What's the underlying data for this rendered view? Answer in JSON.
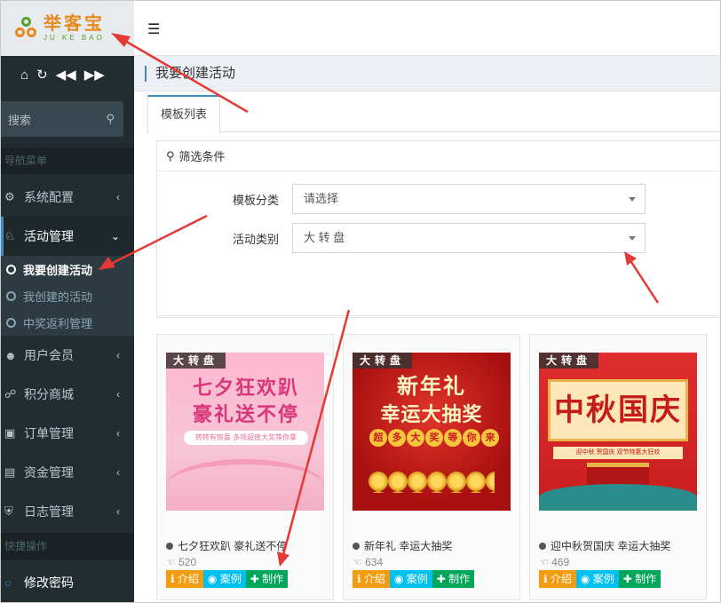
{
  "app": {
    "logo_cn": "举客宝",
    "logo_en": "JU KE BAO"
  },
  "toolbar_icons": [
    "home-icon",
    "refresh-icon",
    "backward-icon",
    "forward-icon"
  ],
  "sidebar": {
    "search_placeholder": "搜索",
    "nav_header": "导航菜单",
    "items": [
      {
        "label": "系统配置",
        "icon": "gear-icon"
      },
      {
        "label": "活动管理",
        "icon": "trophy-icon"
      },
      {
        "label": "用户会员",
        "icon": "users-icon"
      },
      {
        "label": "积分商城",
        "icon": "cart-icon"
      },
      {
        "label": "订单管理",
        "icon": "truck-icon"
      },
      {
        "label": "资金管理",
        "icon": "money-icon"
      },
      {
        "label": "日志管理",
        "icon": "shield-icon"
      }
    ],
    "sub_items": [
      {
        "label": "我要创建活动"
      },
      {
        "label": "我创建的活动"
      },
      {
        "label": "中奖返利管理"
      }
    ],
    "quick_header": "快捷操作",
    "quick_items": [
      {
        "label": "修改密码"
      }
    ]
  },
  "page": {
    "title": "我要创建活动",
    "tab": "模板列表"
  },
  "filter": {
    "header": "筛选条件",
    "rows": [
      {
        "label": "模板分类",
        "value": "请选择"
      },
      {
        "label": "活动类别",
        "value": "大 转 盘"
      }
    ]
  },
  "cards": [
    {
      "badge": "大转盘",
      "title": "七夕狂欢趴 豪礼送不停",
      "likes": "520",
      "img_line1": "七夕狂欢趴",
      "img_line2": "豪礼送不停",
      "img_note": "转转有惊喜 多项超值大奖等你拿"
    },
    {
      "badge": "大转盘",
      "title": "新年礼 幸运大抽奖",
      "likes": "634",
      "img_line1": "新年礼",
      "img_line2": "幸运大抽奖",
      "img_chips": [
        "超",
        "多",
        "大",
        "奖",
        "等",
        "你",
        "来"
      ]
    },
    {
      "badge": "大转盘",
      "title": "迎中秋贺国庆 幸运大抽奖",
      "likes": "469",
      "img_line1": "中秋国庆",
      "img_note": "迎中秋 贺国庆 双节特惠大狂欢"
    }
  ],
  "buttons": {
    "intro": "介绍",
    "case": "案例",
    "make": "制作"
  },
  "colors": {
    "sidebar_bg": "#222d32",
    "accent": "#3c8dbc",
    "intro_btn": "#f39c12",
    "case_btn": "#00c0ef",
    "make_btn": "#00a65a",
    "annotation_arrow": "#e53935"
  }
}
